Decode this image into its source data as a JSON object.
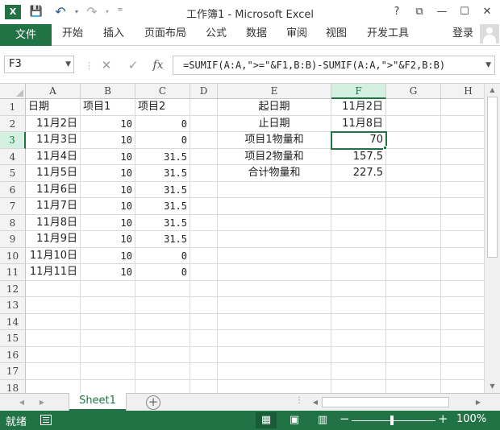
{
  "titlebar": {
    "app_icon": "excel-logo-icon",
    "app_icon_text": "X",
    "title": "工作簿1 - Microsoft Excel",
    "quick_access": [
      {
        "icon": "save-icon",
        "glyph": "💾"
      },
      {
        "icon": "undo-icon",
        "glyph": "↶"
      },
      {
        "icon": "redo-icon",
        "glyph": "↷"
      },
      {
        "icon": "customize-icon",
        "glyph": "⁼"
      }
    ],
    "help_glyph": "?",
    "ribbon_display_glyph": "⧉",
    "minimize_glyph": "—",
    "maximize_glyph": "☐",
    "close_glyph": "✕"
  },
  "ribbon": {
    "file_tab": "文件",
    "tabs": [
      "开始",
      "插入",
      "页面布局",
      "公式",
      "数据",
      "审阅",
      "视图",
      "开发工具"
    ],
    "login": "登录"
  },
  "formula_bar": {
    "name_box": "F3",
    "cancel_glyph": "✕",
    "enter_glyph": "✓",
    "fx_glyph": "fx",
    "formula": "=SUMIF(A:A,\">=\"&F1,B:B)-SUMIF(A:A,\">\"&F2,B:B)"
  },
  "grid": {
    "columns": [
      "A",
      "B",
      "C",
      "D",
      "E",
      "F",
      "G",
      "H"
    ],
    "rows": [
      "1",
      "2",
      "3",
      "4",
      "5",
      "6",
      "7",
      "8",
      "9",
      "10",
      "11",
      "12",
      "13",
      "14",
      "15",
      "16",
      "17",
      "18"
    ],
    "selected_column": "F",
    "selected_row": "3",
    "active_cell": "F3",
    "cells": {
      "A1": "日期",
      "B1": "项目1",
      "C1": "项目2",
      "A2": "11月2日",
      "B2": "10",
      "C2": "0",
      "A3": "11月3日",
      "B3": "10",
      "C3": "0",
      "A4": "11月4日",
      "B4": "10",
      "C4": "31.5",
      "A5": "11月5日",
      "B5": "10",
      "C5": "31.5",
      "A6": "11月6日",
      "B6": "10",
      "C6": "31.5",
      "A7": "11月7日",
      "B7": "10",
      "C7": "31.5",
      "A8": "11月8日",
      "B8": "10",
      "C8": "31.5",
      "A9": "11月9日",
      "B9": "10",
      "C9": "31.5",
      "A10": "11月10日",
      "B10": "10",
      "C10": "0",
      "A11": "11月11日",
      "B11": "10",
      "C11": "0",
      "E1": "起日期",
      "F1": "11月2日",
      "E2": "止日期",
      "F2": "11月8日",
      "E3": "项目1物量和",
      "F3": "70",
      "E4": "项目2物量和",
      "F4": "157.5",
      "E5": "合计物量和",
      "F5": "227.5"
    }
  },
  "sheets": {
    "tabs": [
      "Sheet1"
    ],
    "active": "Sheet1",
    "add_glyph": "+"
  },
  "statusbar": {
    "ready": "就绪",
    "zoom_minus": "−",
    "zoom_plus": "+",
    "zoom": "100%"
  }
}
